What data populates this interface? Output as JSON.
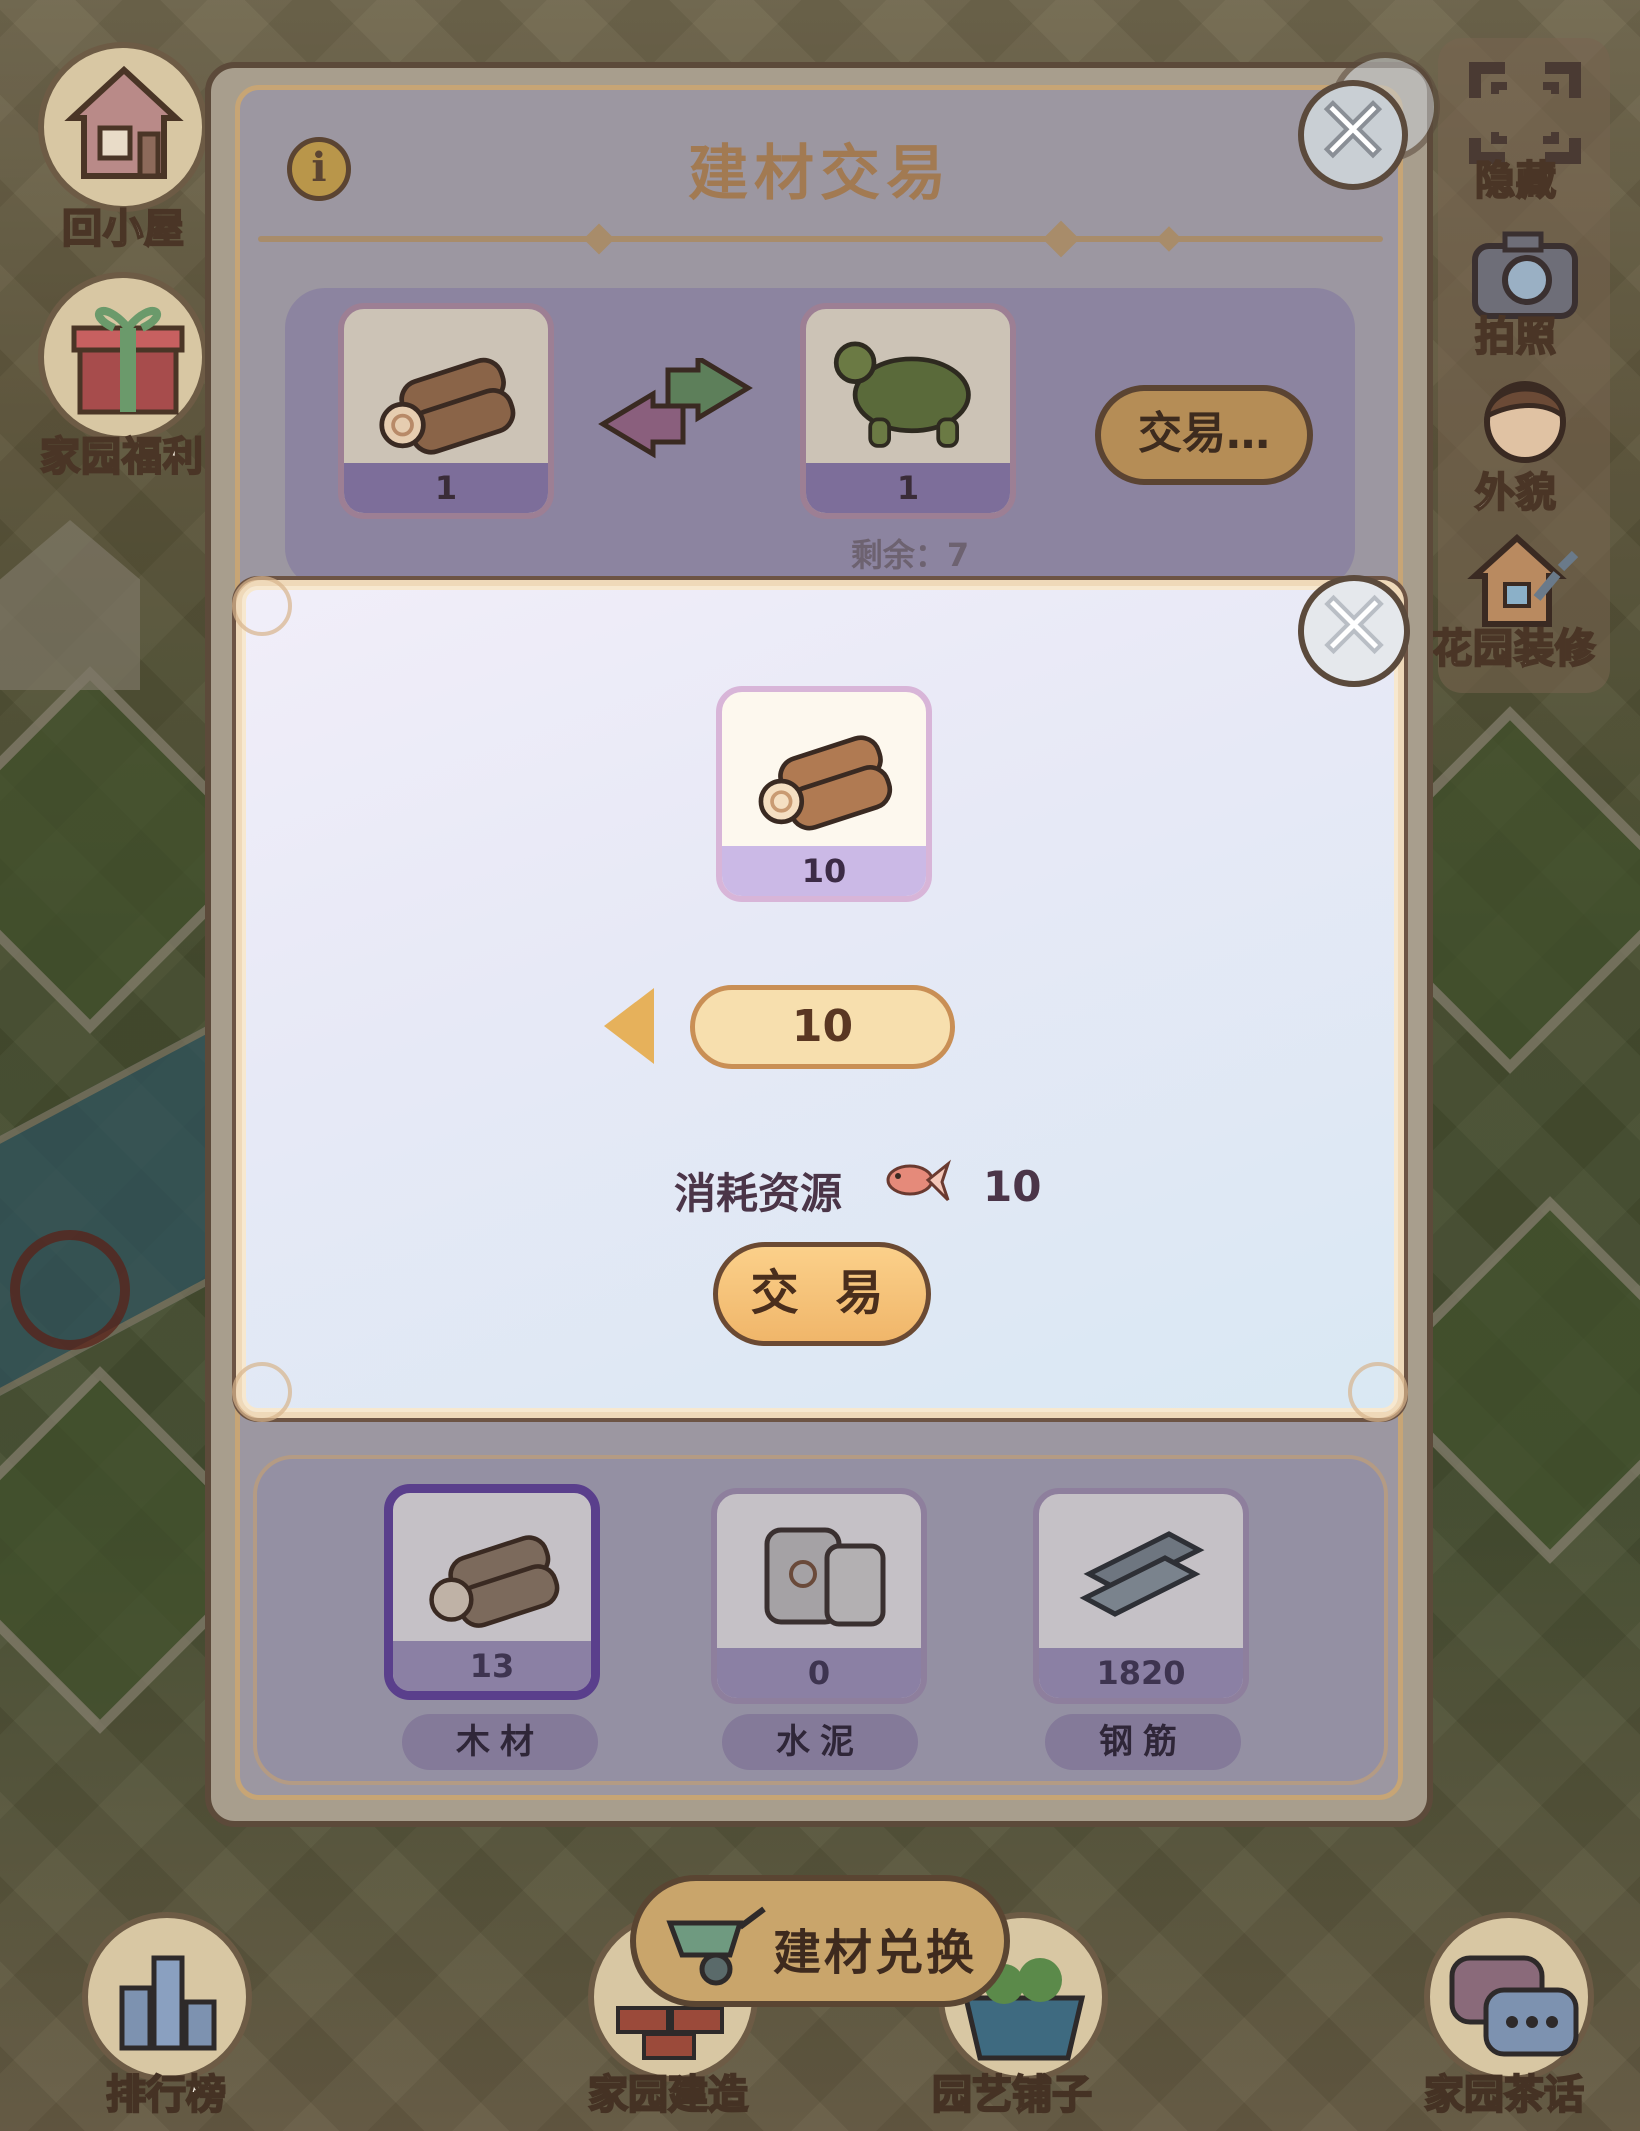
{
  "window": {
    "title": "建材交易",
    "info_icon": "i"
  },
  "side_menu": {
    "left": [
      {
        "label": "回小屋",
        "icon": "house-icon"
      },
      {
        "label": "家园福利",
        "icon": "gift-icon"
      }
    ],
    "right": [
      {
        "label": "隐藏",
        "icon": "hide-icon"
      },
      {
        "label": "拍照",
        "icon": "camera-icon"
      },
      {
        "label": "外貌",
        "icon": "avatar-icon"
      },
      {
        "label": "花园装修",
        "icon": "decorate-icon"
      }
    ]
  },
  "offer": {
    "give": {
      "item": "wood",
      "count": "1"
    },
    "get": {
      "item": "turtle",
      "count": "1"
    },
    "trade_button": "交易…",
    "remaining": "剩余：7"
  },
  "dialog": {
    "item": {
      "name": "wood",
      "count": "10"
    },
    "quantity": "10",
    "cost_label": "消耗资源",
    "cost_icon": "goldfish-icon",
    "cost_value": "10",
    "trade_button": "交 易",
    "close_symbol": "✕"
  },
  "materials": [
    {
      "label": "木材",
      "count": "13",
      "selected": true
    },
    {
      "label": "水泥",
      "count": "0",
      "selected": false
    },
    {
      "label": "钢筋",
      "count": "1820",
      "selected": false
    }
  ],
  "bottom_bar": {
    "items": [
      {
        "label": "排行榜"
      },
      {
        "label": "家园建造"
      },
      {
        "label": "园艺铺子"
      },
      {
        "label": "家园茶话"
      }
    ],
    "exchange_label": "建材兑换"
  }
}
